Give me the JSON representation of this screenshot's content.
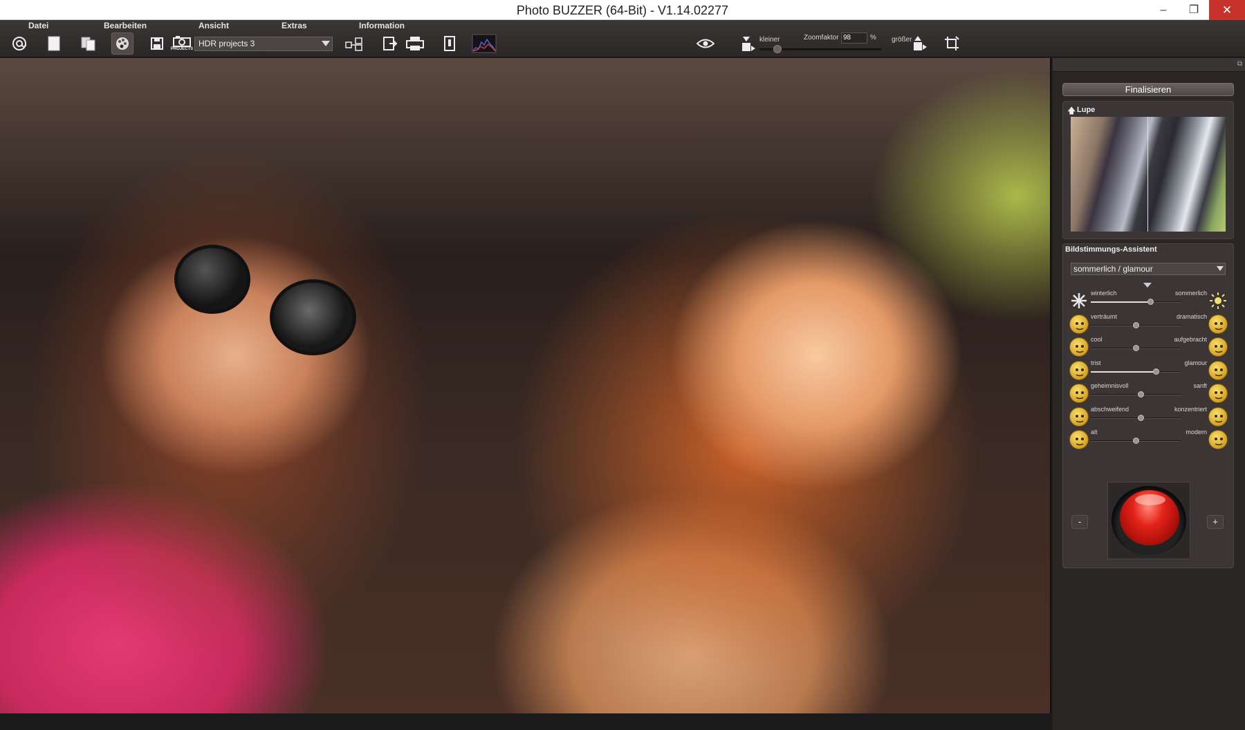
{
  "window": {
    "title": "Photo BUZZER (64-Bit) - V1.14.02277",
    "minimize": "–",
    "maximize": "❐",
    "close": "✕"
  },
  "menu": [
    "Datei",
    "Bearbeiten",
    "Ansicht",
    "Extras",
    "Information"
  ],
  "toolbar": {
    "project_select": "HDR projects 3",
    "projects_caption": "PROJECTS",
    "zoom_smaller": "kleiner",
    "zoom_label": "Zoomfaktor",
    "zoom_value": "98",
    "zoom_unit": "%",
    "zoom_larger": "größer",
    "icons": [
      "at-icon",
      "new-document-icon",
      "copy-documents-icon",
      "palette-icon",
      "save-icon",
      "projects-icon",
      "compare-icon",
      "export-icon",
      "print-icon",
      "info-panel-icon",
      "histogram-icon",
      "eye-icon",
      "zoom-out-icon",
      "zoom-in-icon",
      "crop-icon"
    ]
  },
  "panel": {
    "finalize_label": "Finalisieren",
    "lupe_title": "Lupe",
    "assistant_title": "Bildstimmungs-Assistent",
    "mood_select": "sommerlich / glamour",
    "sliders": [
      {
        "left": "winterlich",
        "right": "sommerlich",
        "value": 0.66
      },
      {
        "left": "verträumt",
        "right": "dramatisch",
        "value": 0.5
      },
      {
        "left": "cool",
        "right": "aufgebracht",
        "value": 0.5
      },
      {
        "left": "trist",
        "right": "glamour",
        "value": 0.72
      },
      {
        "left": "geheimnisvoll",
        "right": "sanft",
        "value": 0.55
      },
      {
        "left": "abschweifend",
        "right": "konzentriert",
        "value": 0.55
      },
      {
        "left": "alt",
        "right": "modern",
        "value": 0.5
      }
    ],
    "minus_label": "-",
    "plus_label": "+"
  }
}
